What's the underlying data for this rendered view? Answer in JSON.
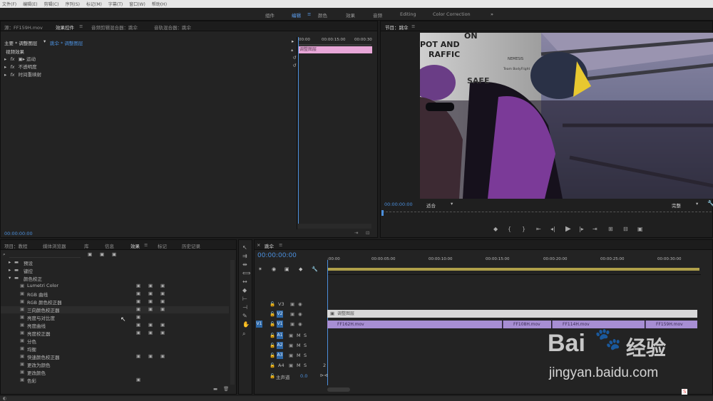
{
  "menu": [
    "文件(F)",
    "编辑(E)",
    "剪辑(C)",
    "序列(S)",
    "标记(M)",
    "字幕(T)",
    "窗口(W)",
    "帮助(H)"
  ],
  "workspaces": [
    "组件",
    "编辑",
    "颜色",
    "效果",
    "音频",
    "Editing",
    "Color Correction"
  ],
  "effect_controls": {
    "tabs": [
      "源：FF159H.mov",
      "效果控件",
      "音频剪辑混合器：跳伞",
      "音轨混合器：跳伞"
    ],
    "master": "主要 * 调整图层",
    "clip": "跳伞 * 调整图层",
    "section": "视频效果",
    "items": [
      "运动",
      "不透明度",
      "时间重映射"
    ],
    "ruler": [
      "00:00",
      "00:00:15:00",
      "00:00:30"
    ],
    "mini_clip": "调整图层",
    "timecode": "00:00:00:00"
  },
  "program": {
    "title": "节目：跳伞",
    "timecode": "00:00:00:00",
    "fit": "适合",
    "quality": "完整",
    "scene_text": [
      "ON",
      "POT AND",
      "RAFFIC",
      "SAFE",
      "NEMESIS",
      "Team BodyFlight"
    ]
  },
  "project": {
    "tabs": [
      "项目：教程",
      "媒体浏览器",
      "库",
      "信息",
      "效果",
      "标记",
      "历史记录"
    ],
    "tree": [
      "预设",
      "键控",
      "颜色校正",
      "Lumetri Color",
      "RGB 曲线",
      "RGB 颜色校正器",
      "三向颜色校正器",
      "亮度与对比度",
      "亮度曲线",
      "亮度校正器",
      "分色",
      "均衡",
      "快速颜色校正器",
      "更改为颜色",
      "更改颜色",
      "色彩"
    ]
  },
  "timeline": {
    "title": "跳伞",
    "timecode": "00:00:00:00",
    "ruler": [
      ":00:00",
      "00:00:05:00",
      "00:00:10:00",
      "00:00:15:00",
      "00:00:20:00",
      "00:00:25:00",
      "00:00:30:00"
    ],
    "tracks": [
      "V3",
      "V2",
      "V1",
      "A1",
      "A2",
      "A3",
      "A4"
    ],
    "master_label": "主声道",
    "master_value": "0.0",
    "a4_num": "2",
    "clips_v1": [
      "FF162H.mov",
      "FF108H.mov",
      "FF114H.mov",
      "FF159H.mov"
    ],
    "clip_v2": "调整图层"
  },
  "watermark": {
    "brand": "Bai",
    "brand2": "经验",
    "url": "jingyan.baidu.com"
  },
  "colors": {
    "accent": "#4b8fdc",
    "adjust_clip": "#e8a7d8",
    "v1_clip": "#a78ed3"
  }
}
